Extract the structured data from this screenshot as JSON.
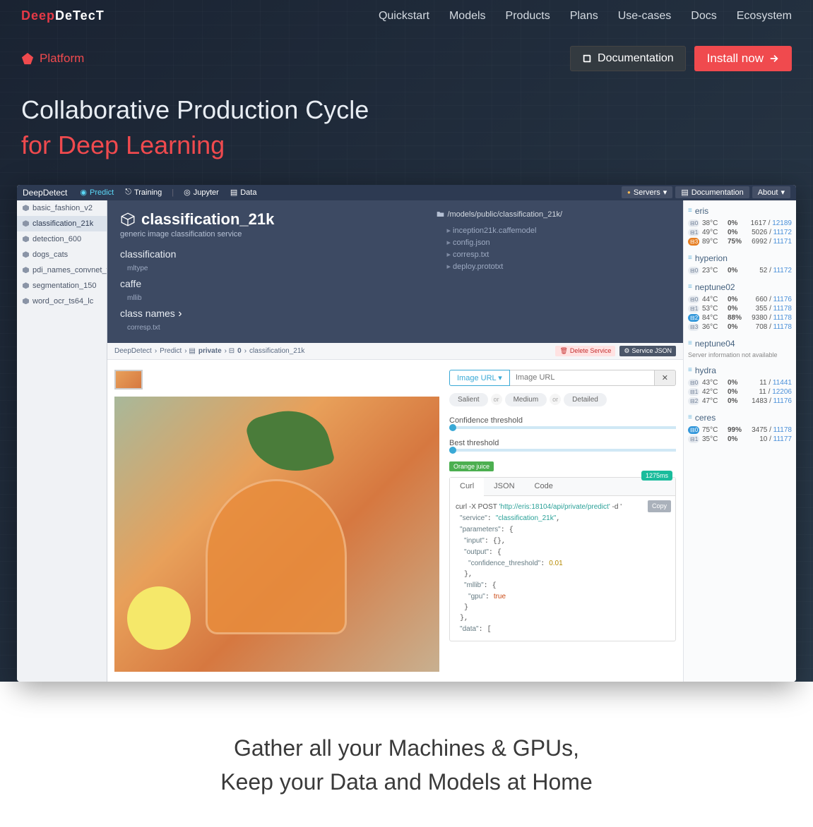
{
  "nav": {
    "logo_part1": "Deep",
    "logo_part2": "DeTecT",
    "items": [
      "Quickstart",
      "Models",
      "Products",
      "Plans",
      "Use-cases",
      "Docs",
      "Ecosystem"
    ]
  },
  "sub": {
    "platform_label": "Platform",
    "doc_label": "Documentation",
    "install_label": "Install now"
  },
  "hero": {
    "line1": "Collaborative Production Cycle",
    "line2": "for Deep Learning"
  },
  "ss": {
    "top": {
      "brand": "DeepDetect",
      "predict": "Predict",
      "training": "Training",
      "jupyter": "Jupyter",
      "data": "Data",
      "servers": "Servers",
      "documentation": "Documentation",
      "about": "About"
    },
    "leftList": [
      "basic_fashion_v2",
      "classification_21k",
      "detection_600",
      "dogs_cats",
      "pdi_names_convnet_we",
      "segmentation_150",
      "word_ocr_ts64_lc"
    ],
    "service": {
      "title": "classification_21k",
      "subtitle": "generic image classification service",
      "meta": [
        {
          "label": "classification",
          "sub": "mltype"
        },
        {
          "label": "caffe",
          "sub": "mllib"
        },
        {
          "label": "class names",
          "sub": "corresp.txt"
        }
      ],
      "path": "/models/public/classification_21k/",
      "files": [
        "inception21k.caffemodel",
        "config.json",
        "corresp.txt",
        "deploy.prototxt"
      ]
    },
    "crumb": [
      "DeepDetect",
      "Predict",
      "private",
      "0",
      "classification_21k"
    ],
    "crumb_private": "private",
    "crumb_zero": "0",
    "delete_label": "Delete Service",
    "json_label": "Service JSON",
    "controls": {
      "url_select": "Image URL",
      "url_placeholder": "Image URL",
      "modes": [
        "Salient",
        "Medium",
        "Detailed"
      ],
      "or": "or",
      "conf_label": "Confidence threshold",
      "best_label": "Best threshold",
      "result_tag": "Orange juice",
      "timing": "1275ms",
      "tabs": [
        "Curl",
        "JSON",
        "Code"
      ],
      "copy": "Copy"
    },
    "code": {
      "l1a": "curl -X POST ",
      "l1b": "'http://eris:18104/api/private/predict'",
      "l1c": " -d '",
      "svc_key": "\"service\"",
      "svc_val": "\"classification_21k\"",
      "params": "\"parameters\"",
      "input": "\"input\"",
      "output": "\"output\"",
      "ct_key": "\"confidence_threshold\"",
      "ct_val": "0.01",
      "mllib": "\"mllib\"",
      "gpu_key": "\"gpu\"",
      "gpu_val": "true",
      "data": "\"data\""
    },
    "servers": [
      {
        "name": "eris",
        "rows": [
          {
            "ico": "0",
            "temp": "38°C",
            "pct": "0%",
            "used": "1617",
            "tot": "12189"
          },
          {
            "ico": "1",
            "temp": "49°C",
            "pct": "0%",
            "used": "5026",
            "tot": "11172"
          },
          {
            "ico": "3",
            "temp": "89°C",
            "pct": "75%",
            "used": "6992",
            "tot": "11171",
            "hot": true
          }
        ]
      },
      {
        "name": "hyperion",
        "rows": [
          {
            "ico": "0",
            "temp": "23°C",
            "pct": "0%",
            "used": "52",
            "tot": "11172"
          }
        ]
      },
      {
        "name": "neptune02",
        "rows": [
          {
            "ico": "0",
            "temp": "44°C",
            "pct": "0%",
            "used": "660",
            "tot": "11176"
          },
          {
            "ico": "1",
            "temp": "53°C",
            "pct": "0%",
            "used": "355",
            "tot": "11178"
          },
          {
            "ico": "2",
            "temp": "84°C",
            "pct": "88%",
            "used": "9380",
            "tot": "11178",
            "hot": true,
            "blue": true
          },
          {
            "ico": "3",
            "temp": "36°C",
            "pct": "0%",
            "used": "708",
            "tot": "11178"
          }
        ]
      },
      {
        "name": "neptune04",
        "na": "Server information not available"
      },
      {
        "name": "hydra",
        "rows": [
          {
            "ico": "0",
            "temp": "43°C",
            "pct": "0%",
            "used": "11",
            "tot": "11441"
          },
          {
            "ico": "1",
            "temp": "42°C",
            "pct": "0%",
            "used": "11",
            "tot": "12206"
          },
          {
            "ico": "2",
            "temp": "47°C",
            "pct": "0%",
            "used": "1483",
            "tot": "11176"
          }
        ]
      },
      {
        "name": "ceres",
        "rows": [
          {
            "ico": "0",
            "temp": "75°C",
            "pct": "99%",
            "used": "3475",
            "tot": "11178",
            "blue": true
          },
          {
            "ico": "1",
            "temp": "35°C",
            "pct": "0%",
            "used": "10",
            "tot": "11177"
          }
        ]
      }
    ]
  },
  "tagline": {
    "l1": "Gather all your Machines & GPUs,",
    "l2": "Keep your Data and Models at Home"
  }
}
